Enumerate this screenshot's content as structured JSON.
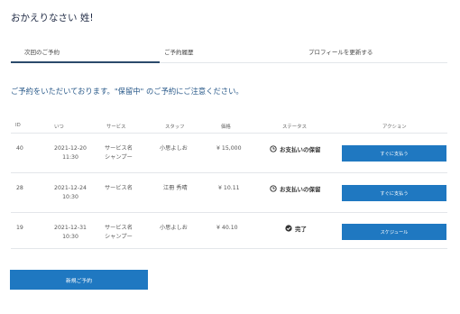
{
  "page": {
    "title": "おかえりなさい 姓!"
  },
  "tabs": [
    {
      "label": "次回のご予約",
      "active": true
    },
    {
      "label": "ご予約履歴",
      "active": false
    },
    {
      "label": "プロフィールを更新する",
      "active": false
    }
  ],
  "notice": "ご予約をいただいております。\"保留中\" のご予約にご注意ください。",
  "table": {
    "headers": {
      "id": "ID",
      "when": "いつ",
      "service": "サービス",
      "staff": "スタッフ",
      "price": "価格",
      "status": "ステータス",
      "action": "アクション"
    },
    "rows": [
      {
        "id": "40",
        "date": "2021-12-20",
        "time": "11:30",
        "service_line1": "サービス名",
        "service_line2": "シャンプー",
        "staff": "小思よしお",
        "price": "¥ 15,000",
        "status": "お支払いの保留",
        "status_icon": "clock-icon",
        "action": "すぐに支払う"
      },
      {
        "id": "28",
        "date": "2021-12-24",
        "time": "10:30",
        "service_line1": "サービス名",
        "service_line2": "",
        "staff": "江冊 秀晴",
        "price": "¥ 10.11",
        "status": "お支払いの保留",
        "status_icon": "clock-icon",
        "action": "すぐに支払う"
      },
      {
        "id": "19",
        "date": "2021-12-31",
        "time": "10:30",
        "service_line1": "サービス名",
        "service_line2": "シャンプー",
        "staff": "小思よしお",
        "price": "¥ 40.10",
        "status": "完了",
        "status_icon": "check-circle-icon",
        "action": "スケジュール"
      }
    ]
  },
  "new_booking_button": "新規ご予約",
  "colors": {
    "primary": "#1f78c1",
    "title": "#1f2a44",
    "notice": "#2a5a8a",
    "tab_underline": "#2b4a6b"
  }
}
